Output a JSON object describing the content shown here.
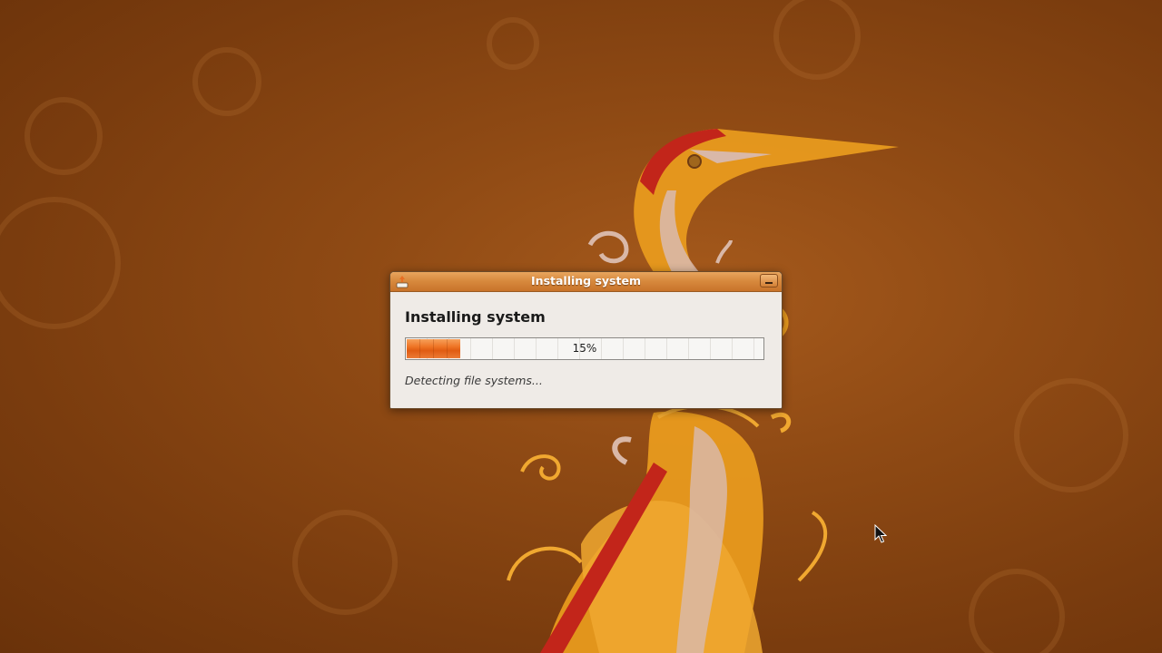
{
  "window": {
    "title": "Installing system",
    "app_icon": "installer-icon",
    "minimize_icon": "minimize-icon"
  },
  "main": {
    "heading": "Installing system",
    "progress": {
      "value_percent": 15,
      "label": "15%"
    },
    "status_text": "Detecting file systems..."
  },
  "colors": {
    "accent": "#e86e22",
    "titlebar": "#d88a3e",
    "dialog_bg": "#efebe7"
  }
}
